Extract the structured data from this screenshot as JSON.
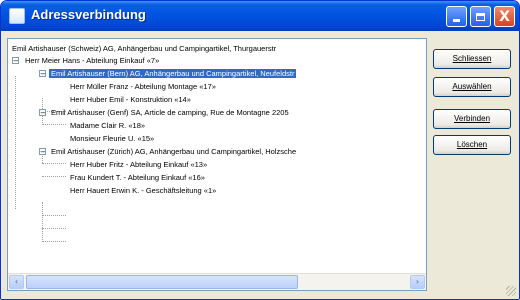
{
  "window": {
    "title": "Adressverbindung"
  },
  "titlebar_buttons": {
    "close_glyph": "X"
  },
  "tree": {
    "items": [
      {
        "label": "Emil Artishauser (Schweiz) AG, Anhängerbau und Campingartikel, Thurgauerstr",
        "expander": ""
      },
      {
        "label": "Herr Meier Hans - Abteilung Einkauf «7»",
        "expander": "−"
      },
      {
        "label": "Emil Artishauser (Bern) AG, Anhängerbau und Campingartikel, Neufeldstr",
        "expander": "−"
      },
      {
        "label": "Herr Müller Franz - Abteilung Montage «17»",
        "expander": ""
      },
      {
        "label": "Herr Huber Emil - Konstruktion «14»",
        "expander": ""
      },
      {
        "label": "Emil Artishauser (Genf) SA, Article de camping, Rue de Montagne 2205",
        "expander": "−"
      },
      {
        "label": "Madame Clair R. «18»",
        "expander": ""
      },
      {
        "label": "Monsieur Fleurie U. «15»",
        "expander": ""
      },
      {
        "label": "Emil Artishauser (Zürich) AG, Anhängerbau und Campingartikel, Holzsche",
        "expander": "−"
      },
      {
        "label": "Herr Huber Fritz - Abteilung Einkauf «13»",
        "expander": ""
      },
      {
        "label": "Frau Kundert T. - Abteilung Einkauf «16»",
        "expander": ""
      },
      {
        "label": "Herr Hauert Erwin K. - Geschäftsleitung «1»",
        "expander": ""
      }
    ],
    "selected_index": 2
  },
  "scrollbar": {
    "left_arrow": "‹",
    "right_arrow": "›"
  },
  "buttons": {
    "schliessen": "Schliessen",
    "auswaehlen": "Auswählen",
    "verbinden": "Verbinden",
    "loeschen": "Löschen"
  },
  "colors": {
    "selection": "#316ac5",
    "titlebar": "#0054e3",
    "window_face": "#ece9d8"
  }
}
